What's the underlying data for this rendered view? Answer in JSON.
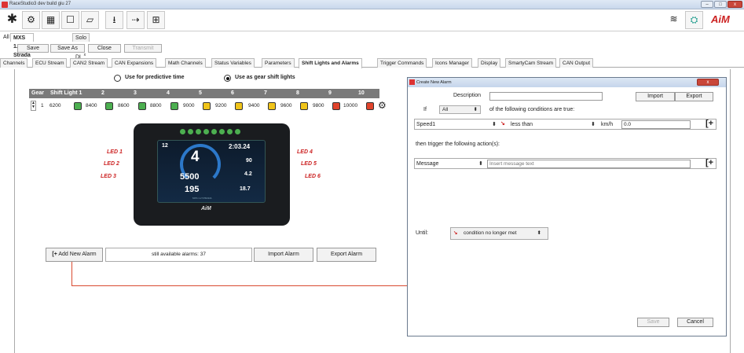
{
  "window": {
    "title": "RaceStudio3 dev  build giu 27",
    "controls": [
      "–",
      "□",
      "x"
    ]
  },
  "toolbar": {
    "icons": [
      "settings-icon",
      "engine-icon",
      "dashboard-icon",
      "track-icon",
      "car-icon",
      "download-icon",
      "transmit-icon",
      "calculator-icon"
    ],
    "right_icons": [
      "wifi-icon",
      "network-icon"
    ],
    "logo": "AiM"
  },
  "device_tabs": {
    "all": "All",
    "active": "MXS 1.2 Strada",
    "active_mark": "x",
    "other": "Solo 2 DL",
    "other_mark": "x"
  },
  "actions": {
    "save": "Save",
    "save_as": "Save As",
    "close": "Close",
    "transmit": "Transmit"
  },
  "tabs": [
    "Channels",
    "ECU Stream",
    "CAN2 Stream",
    "CAN Expansions",
    "Math Channels",
    "Status Variables",
    "Parameters",
    "Shift Lights and Alarms",
    "Trigger Commands",
    "Icons Manager",
    "Display",
    "SmartyCam Stream",
    "CAN Output"
  ],
  "active_tab": "Shift Lights and Alarms",
  "mode": {
    "predictive": "Use for predictive time",
    "gear": "Use as gear shift lights",
    "selected": "gear"
  },
  "shift_table": {
    "headers": [
      "Gear",
      "Shift Light 1",
      "2",
      "3",
      "4",
      "5",
      "6",
      "7",
      "8",
      "9",
      "10"
    ],
    "gear": "1",
    "values": [
      "6200",
      "8400",
      "8600",
      "8800",
      "9000",
      "9200",
      "9400",
      "9600",
      "9800",
      "10000"
    ],
    "colors": [
      "#4caf50",
      "#4caf50",
      "#4caf50",
      "#4caf50",
      "#f0c419",
      "#f0c419",
      "#f0c419",
      "#f0c419",
      "#e0432b",
      "#e0432b"
    ]
  },
  "dash": {
    "leds_left": [
      "LED 1",
      "LED 2",
      "LED 3"
    ],
    "leds_right": [
      "LED 4",
      "LED 5",
      "LED 6"
    ],
    "gear": "4",
    "rpm": "5500",
    "speed": "195",
    "laptime": "2:03.24",
    "water": "90",
    "oil": "4.2",
    "volt": "18.7",
    "brand": "AiM",
    "top": "12",
    "page_label": "MXS 1.2 STRADA"
  },
  "alarm_bar": {
    "add": "Add New Alarm",
    "available": "still available alarms: 37",
    "import": "Import Alarm",
    "export": "Export Alarm"
  },
  "dialog": {
    "title": "Create New Alarm",
    "description_label": "Description",
    "description_value": "",
    "import": "Import",
    "export": "Export",
    "if_label": "If",
    "if_value": "All",
    "if_suffix": "of the following conditions are true:",
    "condition": {
      "channel": "Speed1",
      "operator": "less than",
      "unit": "km/h",
      "value": "0.0"
    },
    "then_label": "then trigger the following action(s):",
    "action": {
      "type": "Message",
      "placeholder": "Insert message text"
    },
    "until_label": "Until:",
    "until_value": "condition no longer met",
    "save": "Save",
    "cancel": "Cancel"
  },
  "colors": {
    "accent_red": "#c22",
    "link_line": "#d94a30"
  }
}
